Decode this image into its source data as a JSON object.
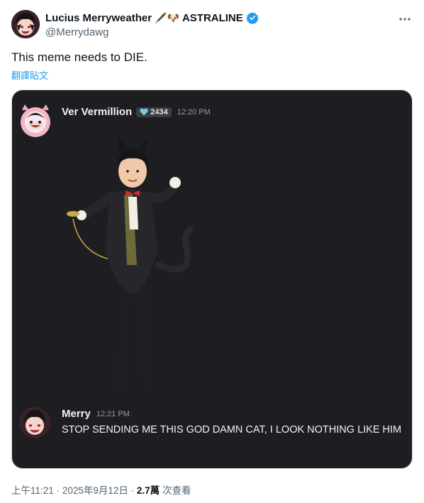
{
  "author": {
    "display_name": "Lucius Merryweather",
    "emoji_suffix": "🖋️🐶",
    "org": "ASTRALINE",
    "handle": "@Merrydawg",
    "verified_color": "#1d9bf0"
  },
  "tweet": {
    "text": "This meme needs to DIE.",
    "translate_label": "翻譯貼文"
  },
  "media": {
    "message1": {
      "name": "Ver Vermillion",
      "badge": "2434",
      "time": "12:20 PM"
    },
    "message2": {
      "name": "Merry",
      "time": "12:21 PM",
      "text": "STOP SENDING ME THIS GOD DAMN CAT, I LOOK NOTHING LIKE HIM"
    },
    "background": "#1e1e22"
  },
  "footer": {
    "time": "上午11:21",
    "date": "2025年9月12日",
    "views": "2.7萬",
    "views_label": "次查看",
    "sep": "·"
  },
  "icons": {
    "more": "more-icon",
    "verified": "verified-badge-icon",
    "badge_heart": "heart-icon"
  }
}
